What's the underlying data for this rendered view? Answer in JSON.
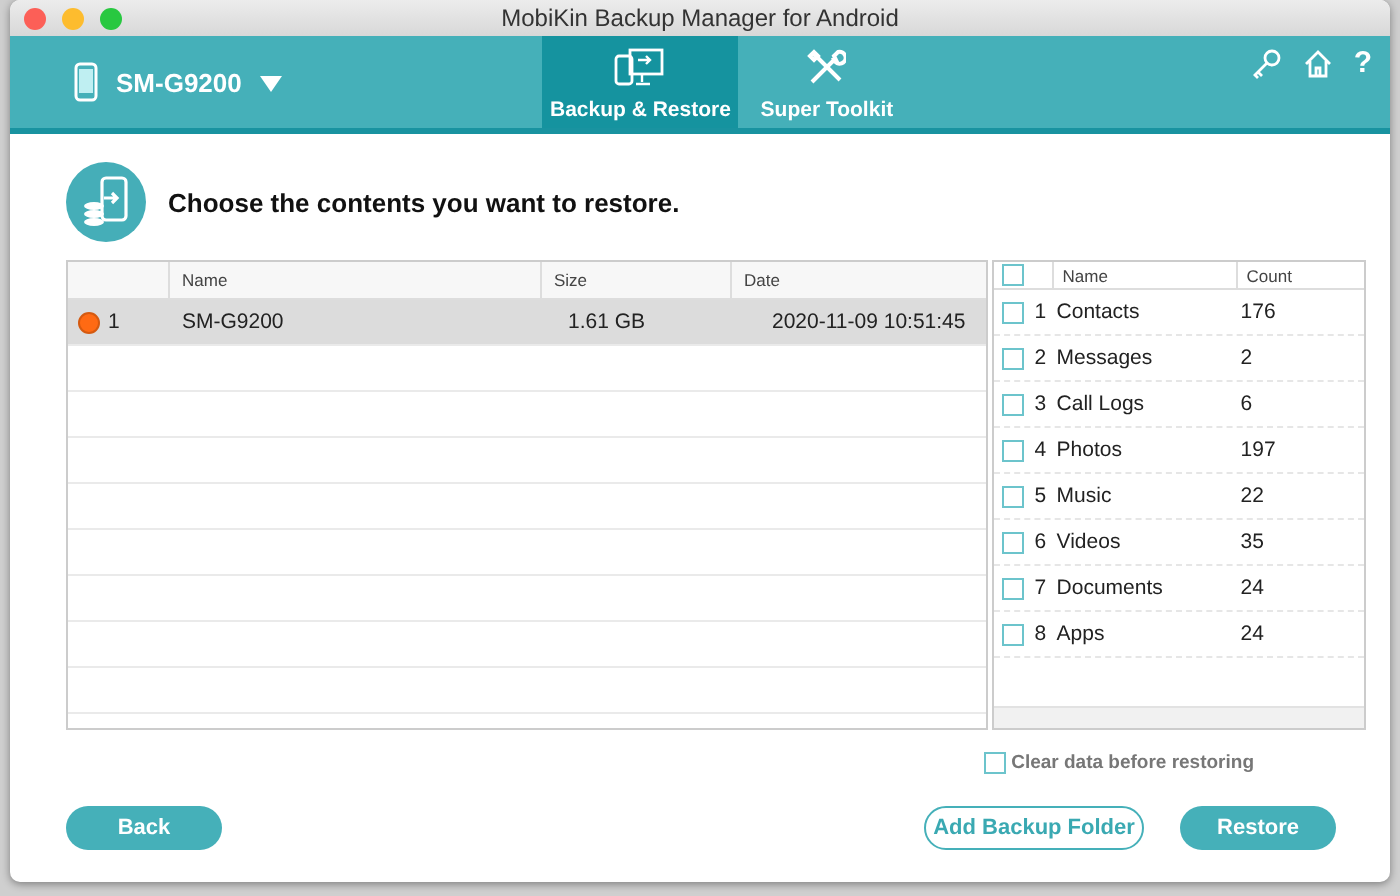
{
  "window": {
    "title": "MobiKin Backup Manager for Android"
  },
  "device": {
    "name": "SM-G9200"
  },
  "nav_tabs": [
    {
      "label": "Backup & Restore",
      "kind": "backup",
      "selected": true
    },
    {
      "label": "Super Toolkit",
      "kind": "toolkit",
      "selected": false
    }
  ],
  "help": "?",
  "heading": "Choose the contents you want to restore.",
  "backups": {
    "columns": [
      "Name",
      "Size",
      "Date"
    ],
    "rows": [
      {
        "index": "1",
        "name": "SM-G9200",
        "size": "1.61 GB",
        "date": "2020-11-09 10:51:45",
        "selected": true
      }
    ]
  },
  "contents": {
    "all_checked": false,
    "columns": [
      "Name",
      "Count"
    ],
    "rows": [
      {
        "index": "1",
        "name": "Contacts",
        "count": "176",
        "checked": false
      },
      {
        "index": "2",
        "name": "Messages",
        "count": "2",
        "checked": false
      },
      {
        "index": "3",
        "name": "Call Logs",
        "count": "6",
        "checked": false
      },
      {
        "index": "4",
        "name": "Photos",
        "count": "197",
        "checked": false
      },
      {
        "index": "5",
        "name": "Music",
        "count": "22",
        "checked": false
      },
      {
        "index": "6",
        "name": "Videos",
        "count": "35",
        "checked": false
      },
      {
        "index": "7",
        "name": "Documents",
        "count": "24",
        "checked": false
      },
      {
        "index": "8",
        "name": "Apps",
        "count": "24",
        "checked": false
      }
    ]
  },
  "clear_data": {
    "label": "Clear data before restoring",
    "checked": false
  },
  "buttons": [
    {
      "label": "Back",
      "kind": "filled"
    },
    {
      "label": "Add Backup Folder",
      "kind": "outline"
    },
    {
      "label": "Restore",
      "kind": "filled"
    }
  ]
}
